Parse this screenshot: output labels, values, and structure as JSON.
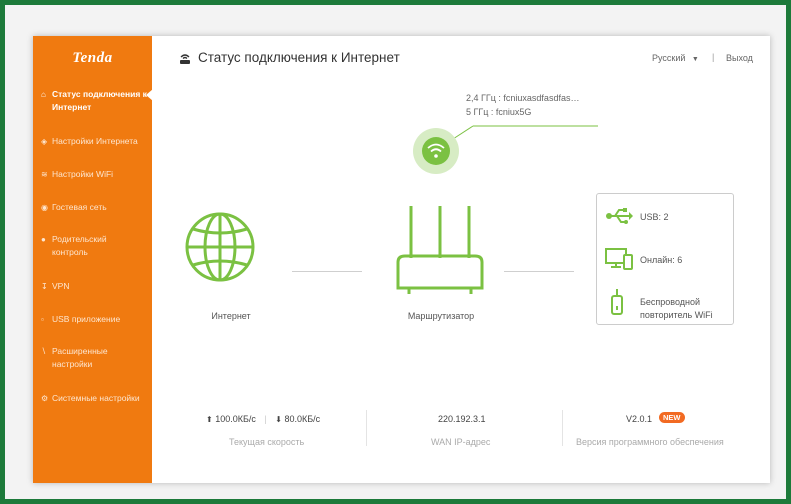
{
  "sidebar": {
    "logo": "Tenda",
    "items": [
      {
        "label": "Статус подключения к Интернет",
        "icon": "home-icon",
        "active": true
      },
      {
        "label": "Настройки Интернета",
        "icon": "globe-icon"
      },
      {
        "label": "Настройки WiFi",
        "icon": "wifi-icon"
      },
      {
        "label": "Гостевая сеть",
        "icon": "guest-icon"
      },
      {
        "label": "Родительский контроль",
        "icon": "parental-icon"
      },
      {
        "label": "VPN",
        "icon": "vpn-icon"
      },
      {
        "label": "USB приложение",
        "icon": "usb-icon"
      },
      {
        "label": "Расширенные настройки",
        "icon": "wrench-icon"
      },
      {
        "label": "Системные настройки",
        "icon": "gear-icon"
      }
    ]
  },
  "header": {
    "title": "Статус подключения к Интернет",
    "language": "Русский",
    "separator": "|",
    "logout": "Выход"
  },
  "wifi": {
    "band_24": "2,4 ГГц : fcniuxasdfasdfas…",
    "band_5": "5 ГГц : fcniux5G"
  },
  "diagram": {
    "internet_label": "Интернет",
    "router_label": "Маршрутизатор"
  },
  "devices": {
    "usb_label": "USB:",
    "usb_count": "2",
    "online_label": "Онлайн:",
    "online_count": "6",
    "repeater_line1": "Беспроводной",
    "repeater_line2": "повторитель WiFi"
  },
  "stats": {
    "upload": "100.0КБ/с",
    "divider": "|",
    "download": "80.0КБ/с",
    "speed_label": "Текущая скорость",
    "wan_ip": "220.192.3.1",
    "wan_label": "WAN IP-адрес",
    "firmware": "V2.0.1",
    "new_badge": "NEW",
    "firmware_label": "Версия программного обеспечения"
  },
  "colors": {
    "accent_orange": "#f07a10",
    "green": "#7bc142",
    "background": "#1d7a3a"
  }
}
